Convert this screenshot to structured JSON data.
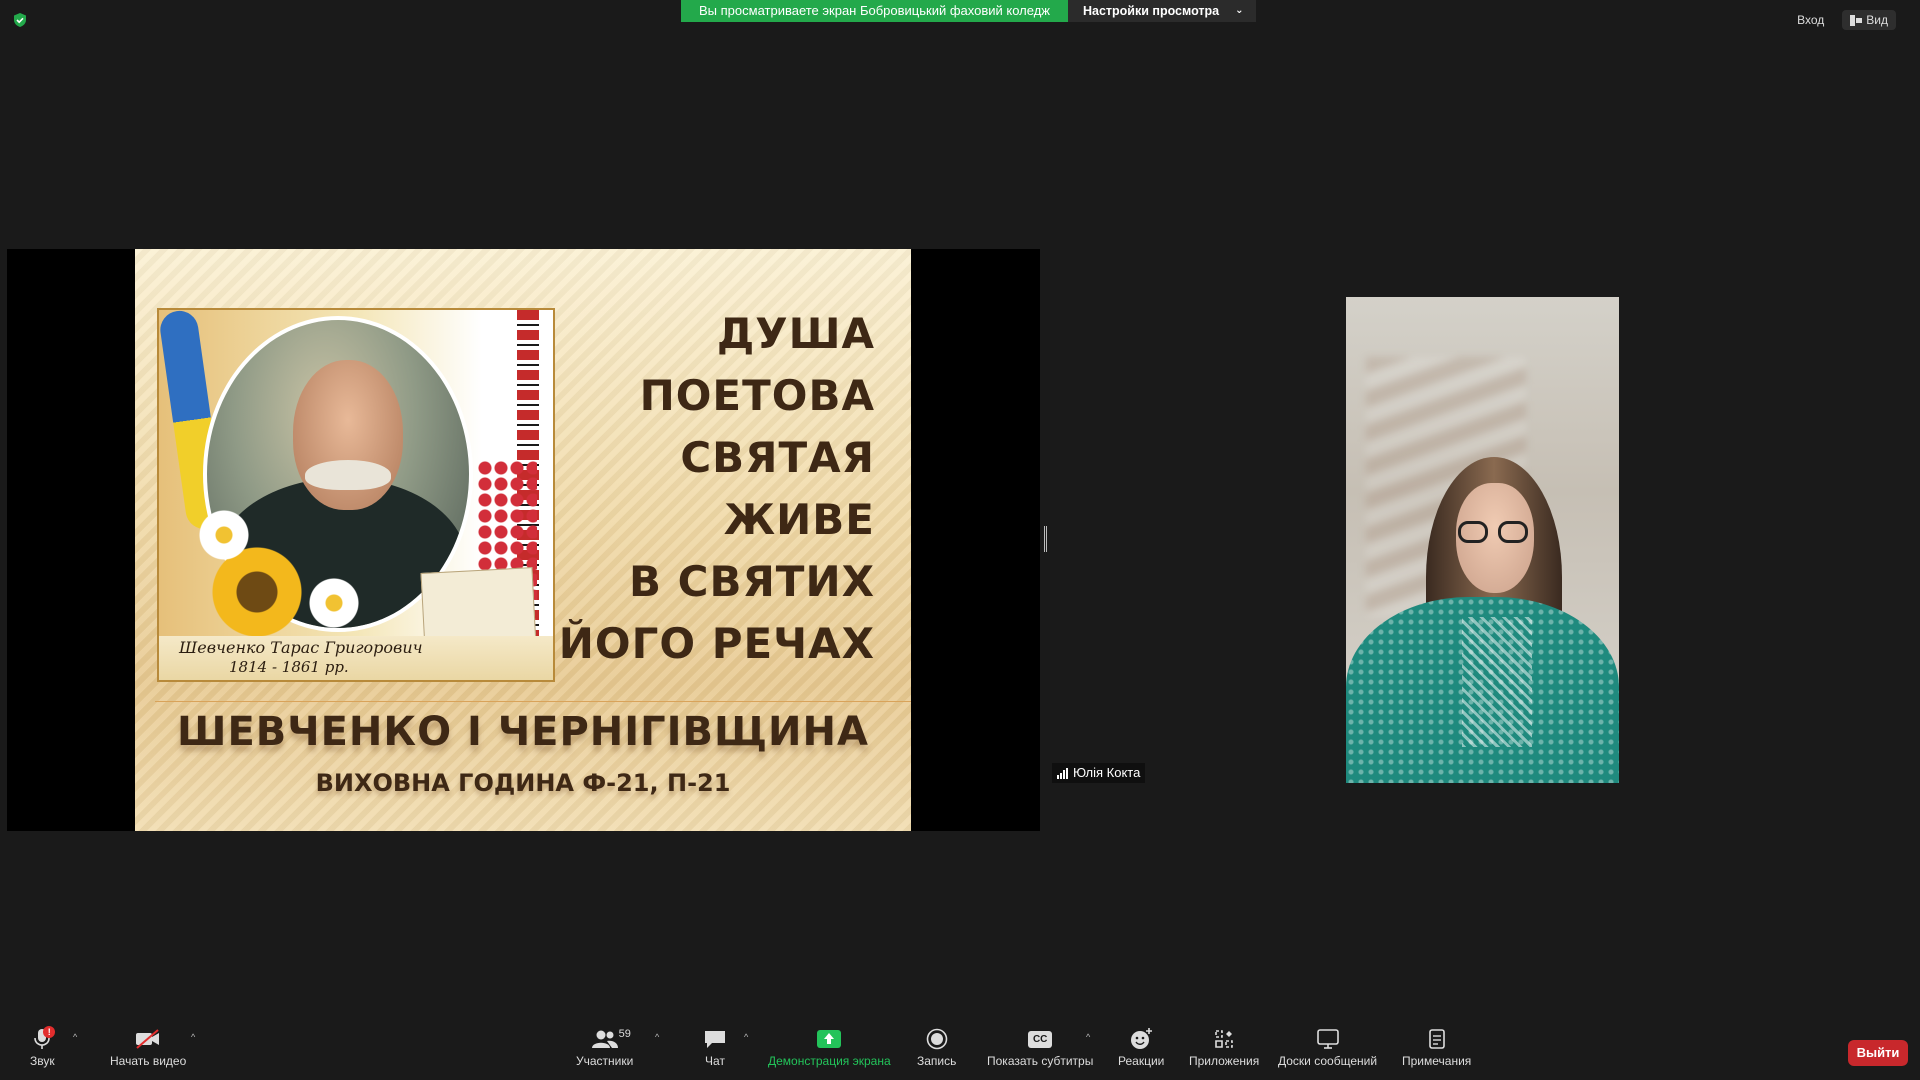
{
  "top_bar": {
    "viewing_banner": "Вы просматриваете экран Бобровицький фаховий коледж",
    "view_settings_label": "Настройки просмотра",
    "signin_label": "Вход",
    "view_label": "Вид"
  },
  "slide": {
    "title_lines": [
      "ДУША",
      "ПОЕТОВА",
      "СВЯТАЯ",
      "ЖИВЕ",
      "В СВЯТИХ",
      "ЙОГО РЕЧАХ"
    ],
    "subtitle": "ШЕВЧЕНКО І ЧЕРНІГІВЩИНА",
    "subtitle2": "ВИХОВНА ГОДИНА Ф-21, П-21",
    "portrait_name": "Шевченко Тарас Григорович",
    "portrait_years": "1814 - 1861 рр."
  },
  "participant": {
    "name": "Юлія Кокта"
  },
  "toolbar": {
    "mute_label": "Звук",
    "mute_badge": "!",
    "video_label": "Начать видео",
    "participants_label": "Участники",
    "participants_count": "59",
    "chat_label": "Чат",
    "share_label": "Демонстрация экрана",
    "record_label": "Запись",
    "cc_label": "Показать субтитры",
    "cc_icon_text": "CC",
    "reactions_label": "Реакции",
    "apps_label": "Приложения",
    "whiteboards_label": "Доски сообщений",
    "notes_label": "Примечания",
    "leave_label": "Выйти"
  },
  "colors": {
    "share_green": "#23a94b",
    "leave_red": "#c8282c",
    "background": "#1a1a1a"
  }
}
